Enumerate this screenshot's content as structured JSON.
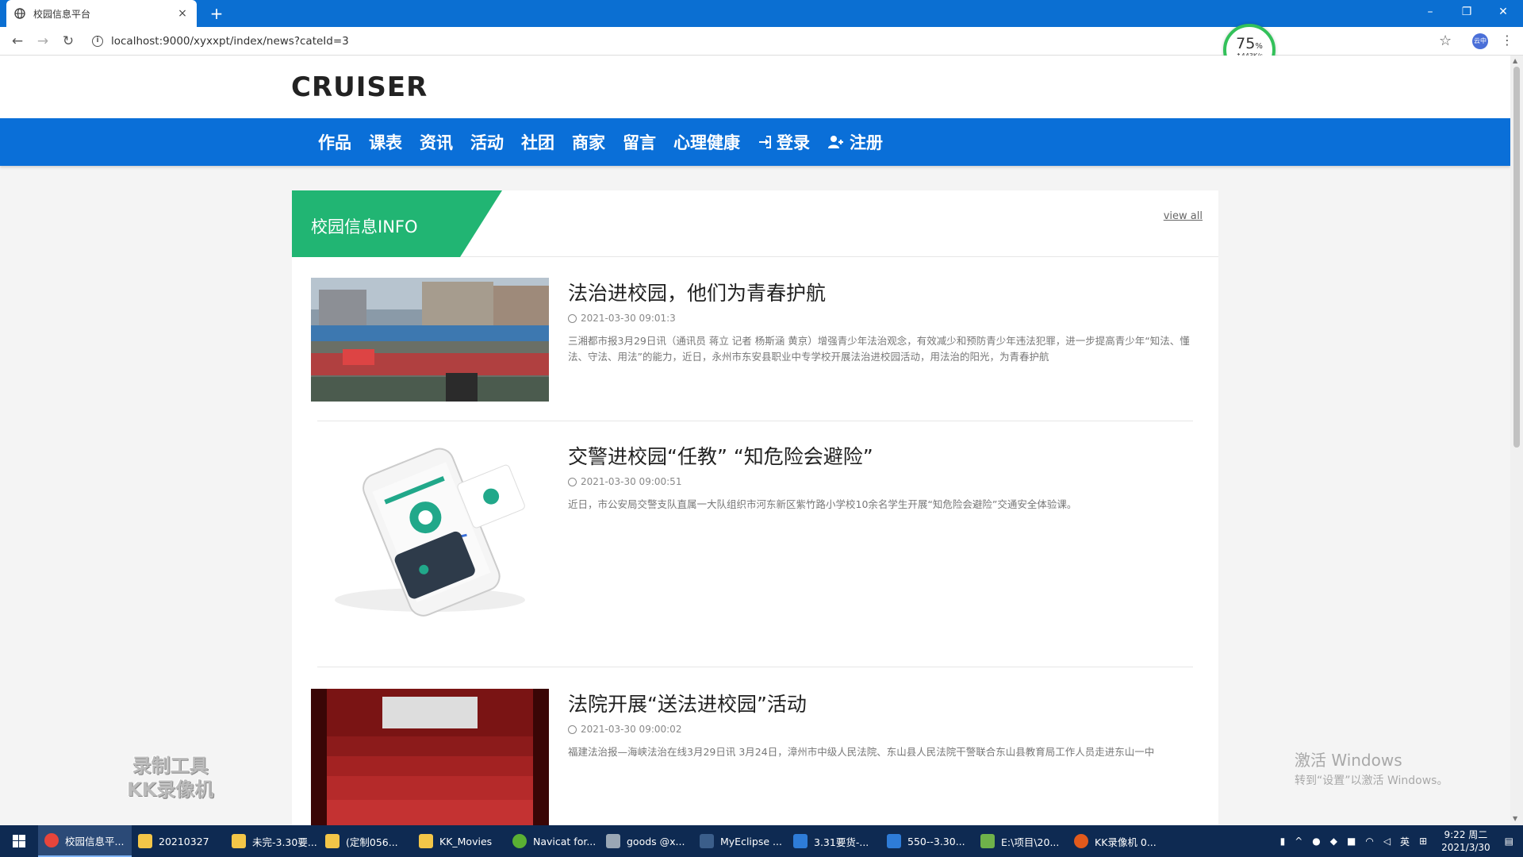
{
  "browser": {
    "tab_title": "校园信息平台",
    "tab_close": "×",
    "new_tab": "+",
    "url": "localhost:9000/xyxxpt/index/news?cateId=3",
    "win_min": "–",
    "win_restore": "❐",
    "win_close": "✕",
    "profile": "云中",
    "speed_percent": "75",
    "speed_unit": "%",
    "speed_rate": "↑443K/s"
  },
  "site": {
    "logo": "CRUISER",
    "nav": [
      "作品",
      "课表",
      "资讯",
      "活动",
      "社团",
      "商家",
      "留言",
      "心理健康"
    ],
    "login": "登录",
    "register": "注册"
  },
  "panel": {
    "title": "校园信息INFO",
    "view_all": "view all"
  },
  "news": [
    {
      "title": "法治进校园，他们为青春护航",
      "date": "2021-03-30 09:01:3",
      "summary": "三湘都市报3月29日讯（通讯员 蒋立 记者 杨斯涵 黄京）增强青少年法治观念，有效减少和预防青少年违法犯罪，进一步提高青少年“知法、懂法、守法、用法”的能力，近日，永州市东安县职业中专学校开展法治进校园活动，用法治的阳光，为青春护航"
    },
    {
      "title": "交警进校园“任教” “知危险会避险”",
      "date": "2021-03-30 09:00:51",
      "summary": "近日，市公安局交警支队直属一大队组织市河东新区紫竹路小学校10余名学生开展“知危险会避险”交通安全体验课。"
    },
    {
      "title": "法院开展“送法进校园”活动",
      "date": "2021-03-30 09:00:02",
      "summary": "福建法治报—海峡法治在线3月29日讯 3月24日，漳州市中级人民法院、东山县人民法院干警联合东山县教育局工作人员走进东山一中"
    }
  ],
  "overlay": {
    "kk_line1": "录制工具",
    "kk_line2": "KK录像机",
    "activate_line1": "激活 Windows",
    "activate_line2": "转到“设置”以激活 Windows。"
  },
  "taskbar": {
    "items": [
      "校园信息平...",
      "20210327",
      "未完-3.30要...",
      "(定制056...",
      "KK_Movies",
      "Navicat for...",
      "goods @x...",
      "MyEclipse ...",
      "3.31要货-...",
      "550--3.30...",
      "E:\\项目\\20...",
      "KK录像机 0..."
    ],
    "ime": "英",
    "time": "9:22 周二",
    "date": "2021/3/30"
  },
  "colors": {
    "titlebar": "#0b6fd2",
    "nav": "#0a6fd8",
    "ribbon": "#21b573",
    "taskbar": "#0e2a52"
  }
}
